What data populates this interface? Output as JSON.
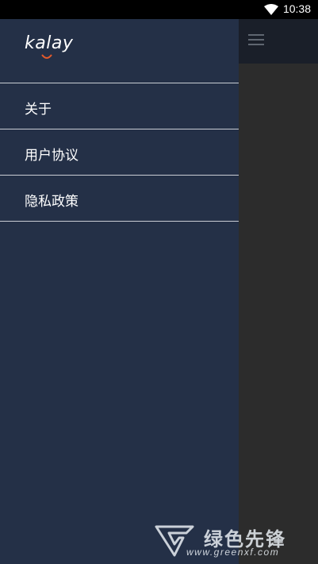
{
  "status_bar": {
    "time": "10:38",
    "icons": [
      "wifi-icon"
    ]
  },
  "toolbar": {
    "menu_icon": "menu-icon"
  },
  "drawer": {
    "logo_text": "kalay",
    "items": [
      {
        "label": "关于"
      },
      {
        "label": "用户协议"
      },
      {
        "label": "隐私政策"
      }
    ]
  },
  "watermark": {
    "text": "绿色先锋",
    "url": "www.greenxf.com"
  },
  "colors": {
    "drawer_bg": "#243047",
    "toolbar_bg": "#1a1f29",
    "divider": "#c9cdd4",
    "logo_accent": "#e35a2b"
  }
}
